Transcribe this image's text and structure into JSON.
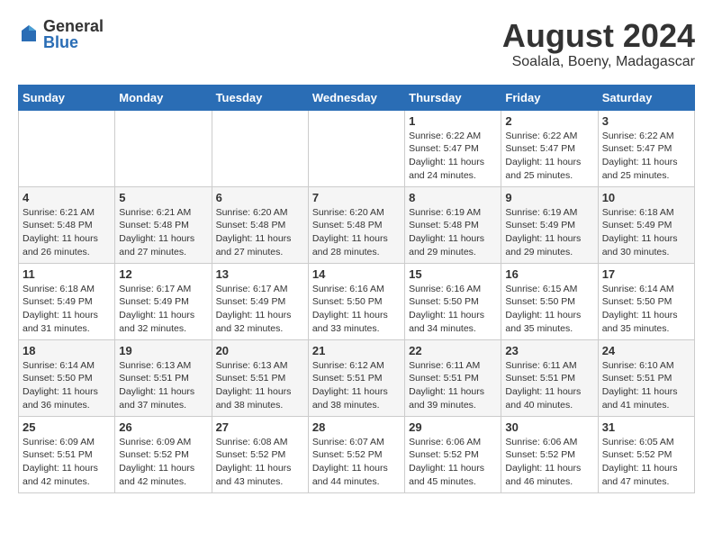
{
  "header": {
    "logo_general": "General",
    "logo_blue": "Blue",
    "month_year": "August 2024",
    "location": "Soalala, Boeny, Madagascar"
  },
  "days_of_week": [
    "Sunday",
    "Monday",
    "Tuesday",
    "Wednesday",
    "Thursday",
    "Friday",
    "Saturday"
  ],
  "weeks": [
    [
      {
        "day": "",
        "info": ""
      },
      {
        "day": "",
        "info": ""
      },
      {
        "day": "",
        "info": ""
      },
      {
        "day": "",
        "info": ""
      },
      {
        "day": "1",
        "info": "Sunrise: 6:22 AM\nSunset: 5:47 PM\nDaylight: 11 hours and 24 minutes."
      },
      {
        "day": "2",
        "info": "Sunrise: 6:22 AM\nSunset: 5:47 PM\nDaylight: 11 hours and 25 minutes."
      },
      {
        "day": "3",
        "info": "Sunrise: 6:22 AM\nSunset: 5:47 PM\nDaylight: 11 hours and 25 minutes."
      }
    ],
    [
      {
        "day": "4",
        "info": "Sunrise: 6:21 AM\nSunset: 5:48 PM\nDaylight: 11 hours and 26 minutes."
      },
      {
        "day": "5",
        "info": "Sunrise: 6:21 AM\nSunset: 5:48 PM\nDaylight: 11 hours and 27 minutes."
      },
      {
        "day": "6",
        "info": "Sunrise: 6:20 AM\nSunset: 5:48 PM\nDaylight: 11 hours and 27 minutes."
      },
      {
        "day": "7",
        "info": "Sunrise: 6:20 AM\nSunset: 5:48 PM\nDaylight: 11 hours and 28 minutes."
      },
      {
        "day": "8",
        "info": "Sunrise: 6:19 AM\nSunset: 5:48 PM\nDaylight: 11 hours and 29 minutes."
      },
      {
        "day": "9",
        "info": "Sunrise: 6:19 AM\nSunset: 5:49 PM\nDaylight: 11 hours and 29 minutes."
      },
      {
        "day": "10",
        "info": "Sunrise: 6:18 AM\nSunset: 5:49 PM\nDaylight: 11 hours and 30 minutes."
      }
    ],
    [
      {
        "day": "11",
        "info": "Sunrise: 6:18 AM\nSunset: 5:49 PM\nDaylight: 11 hours and 31 minutes."
      },
      {
        "day": "12",
        "info": "Sunrise: 6:17 AM\nSunset: 5:49 PM\nDaylight: 11 hours and 32 minutes."
      },
      {
        "day": "13",
        "info": "Sunrise: 6:17 AM\nSunset: 5:49 PM\nDaylight: 11 hours and 32 minutes."
      },
      {
        "day": "14",
        "info": "Sunrise: 6:16 AM\nSunset: 5:50 PM\nDaylight: 11 hours and 33 minutes."
      },
      {
        "day": "15",
        "info": "Sunrise: 6:16 AM\nSunset: 5:50 PM\nDaylight: 11 hours and 34 minutes."
      },
      {
        "day": "16",
        "info": "Sunrise: 6:15 AM\nSunset: 5:50 PM\nDaylight: 11 hours and 35 minutes."
      },
      {
        "day": "17",
        "info": "Sunrise: 6:14 AM\nSunset: 5:50 PM\nDaylight: 11 hours and 35 minutes."
      }
    ],
    [
      {
        "day": "18",
        "info": "Sunrise: 6:14 AM\nSunset: 5:50 PM\nDaylight: 11 hours and 36 minutes."
      },
      {
        "day": "19",
        "info": "Sunrise: 6:13 AM\nSunset: 5:51 PM\nDaylight: 11 hours and 37 minutes."
      },
      {
        "day": "20",
        "info": "Sunrise: 6:13 AM\nSunset: 5:51 PM\nDaylight: 11 hours and 38 minutes."
      },
      {
        "day": "21",
        "info": "Sunrise: 6:12 AM\nSunset: 5:51 PM\nDaylight: 11 hours and 38 minutes."
      },
      {
        "day": "22",
        "info": "Sunrise: 6:11 AM\nSunset: 5:51 PM\nDaylight: 11 hours and 39 minutes."
      },
      {
        "day": "23",
        "info": "Sunrise: 6:11 AM\nSunset: 5:51 PM\nDaylight: 11 hours and 40 minutes."
      },
      {
        "day": "24",
        "info": "Sunrise: 6:10 AM\nSunset: 5:51 PM\nDaylight: 11 hours and 41 minutes."
      }
    ],
    [
      {
        "day": "25",
        "info": "Sunrise: 6:09 AM\nSunset: 5:51 PM\nDaylight: 11 hours and 42 minutes."
      },
      {
        "day": "26",
        "info": "Sunrise: 6:09 AM\nSunset: 5:52 PM\nDaylight: 11 hours and 42 minutes."
      },
      {
        "day": "27",
        "info": "Sunrise: 6:08 AM\nSunset: 5:52 PM\nDaylight: 11 hours and 43 minutes."
      },
      {
        "day": "28",
        "info": "Sunrise: 6:07 AM\nSunset: 5:52 PM\nDaylight: 11 hours and 44 minutes."
      },
      {
        "day": "29",
        "info": "Sunrise: 6:06 AM\nSunset: 5:52 PM\nDaylight: 11 hours and 45 minutes."
      },
      {
        "day": "30",
        "info": "Sunrise: 6:06 AM\nSunset: 5:52 PM\nDaylight: 11 hours and 46 minutes."
      },
      {
        "day": "31",
        "info": "Sunrise: 6:05 AM\nSunset: 5:52 PM\nDaylight: 11 hours and 47 minutes."
      }
    ]
  ]
}
